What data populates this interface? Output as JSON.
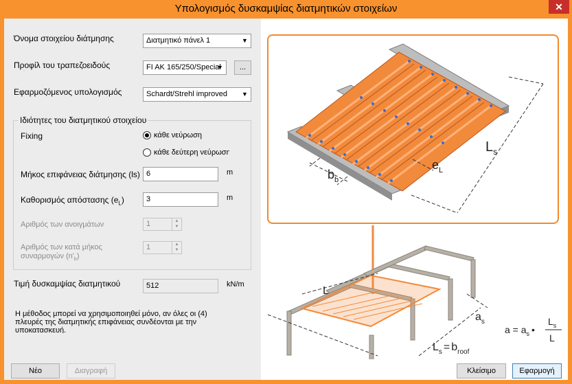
{
  "window": {
    "title": "Υπολογισμός δυσκαμψίας διατμητικών στοιχείων",
    "close": "✕"
  },
  "form": {
    "element_name_label": "Όνομα στοιχείου διάτμησης",
    "element_name_value": "Διατμητικό πάνελ 1",
    "profile_label": "Προφίλ του τραπεζοειδούς ελάσματος",
    "profile_value": "FI AK 165/250/Special",
    "profile_browse": "...",
    "calc_label": "Εφαρμοζόμενος υπολογισμός",
    "calc_value": "Schardt/Strehl improved",
    "group_title": "Ιδιότητες του διατμητικού στοιχείου",
    "fixing_label": "Fixing",
    "fixing_options": [
      "κάθε νεύρωση",
      "κάθε δεύτερη νεύρωση"
    ],
    "fixing_selected": 0,
    "length_label": "Μήκος επιφάνειας διάτμησης (ls)",
    "length_value": "6",
    "length_unit": "m",
    "distance_label": "Καθορισμός απόστασης (e",
    "distance_label_sub": "L",
    "distance_label_end": ")",
    "distance_value": "3",
    "distance_unit": "m",
    "spans_label": "Αριθμός των ανοιγμάτων",
    "spans_value": "1",
    "joints_label_1": "Αριθμός των κατά μήκος",
    "joints_label_2": "συναρμογών (n'",
    "joints_label_sub": "b",
    "joints_label_end": ")",
    "joints_value": "1",
    "stiffness_label": "Τιμή δυσκαμψίας διατμητικού στοιχείου",
    "stiffness_value": "512",
    "stiffness_unit": "kN/m",
    "note": "Η μέθοδος μπορεί να χρησιμοποιηθεί μόνο, αν όλες οι (4) πλευρές της διατμητικής επιφάνειας συνδέονται με την υποκατασκευή."
  },
  "figure": {
    "label_ls": "L",
    "label_ls_sub": "s",
    "label_bb": "b",
    "label_bb_sub": "b",
    "label_el": "e",
    "label_el_sub": "L",
    "label_L": "L",
    "label_as": "a",
    "label_as_sub": "s",
    "eq_ls": "L",
    "eq_ls_sub": "s",
    "eq_eq": "=",
    "eq_broof": "b",
    "eq_broof_sub": "roof",
    "formula_a": "a = a",
    "formula_a_sub": "s",
    "formula_dot": "•",
    "formula_num": "L",
    "formula_num_sub": "s",
    "formula_den": "L"
  },
  "buttons": {
    "new": "Νέο",
    "delete": "Διαγραφή",
    "close": "Κλείσιμο",
    "apply": "Εφαρμογή"
  },
  "colors": {
    "accent": "#f7922e",
    "sheet": "#f28a3c"
  }
}
